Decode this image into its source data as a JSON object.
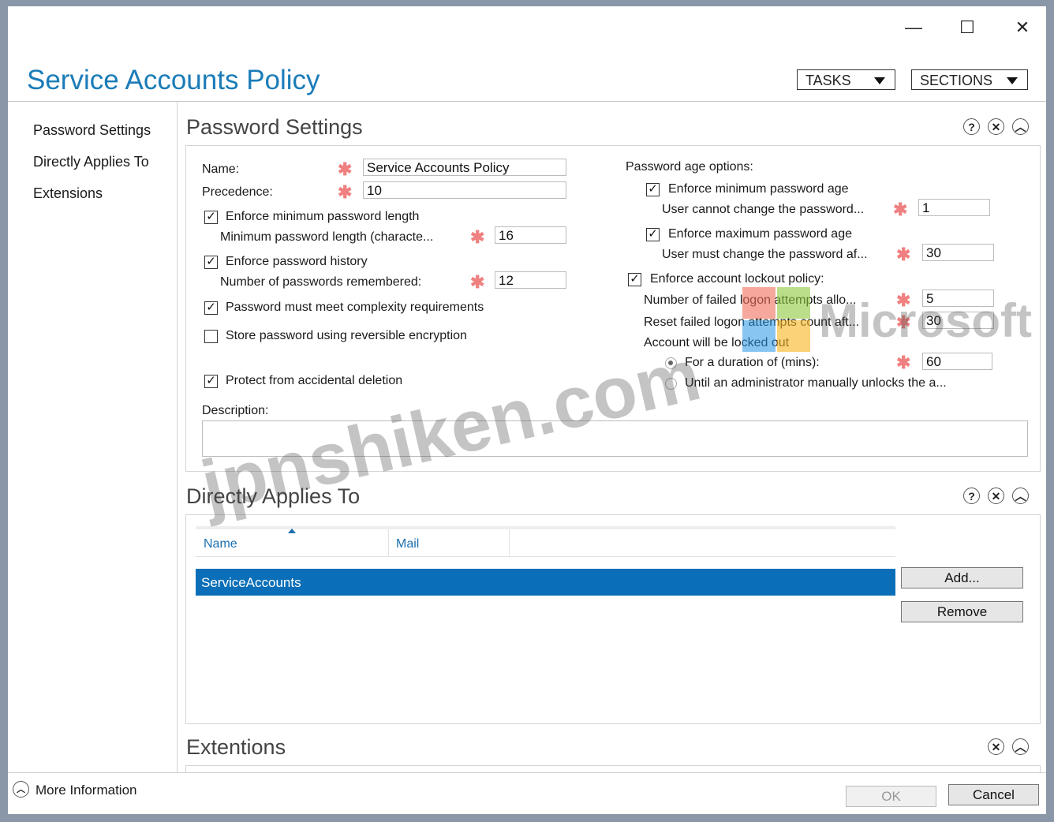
{
  "window": {
    "controls": {
      "minimize": "—",
      "maximize": "☐",
      "close": "✕"
    },
    "title": "Service Accounts Policy",
    "tasks_label": "TASKS",
    "sections_label": "SECTIONS"
  },
  "nav": {
    "items": [
      {
        "label": "Password Settings"
      },
      {
        "label": "Directly Applies To"
      },
      {
        "label": "Extensions"
      }
    ]
  },
  "password_settings": {
    "title": "Password Settings",
    "name_label": "Name:",
    "name_value": "Service Accounts Policy",
    "precedence_label": "Precedence:",
    "precedence_value": "10",
    "enforce_min_length": {
      "label": "Enforce minimum password length",
      "checked": true
    },
    "min_length_label": "Minimum password length (characte...",
    "min_length_value": "16",
    "enforce_history": {
      "label": "Enforce password history",
      "checked": true
    },
    "history_label": "Number of passwords remembered:",
    "history_value": "12",
    "complexity": {
      "label": "Password must meet complexity requirements",
      "checked": true
    },
    "reversible": {
      "label": "Store password using reversible encryption",
      "checked": false
    },
    "protect": {
      "label": "Protect from accidental deletion",
      "checked": true
    },
    "description_label": "Description:",
    "age_options_label": "Password age options:",
    "enforce_min_age": {
      "label": "Enforce minimum password age",
      "checked": true
    },
    "min_age_label": "User cannot change the password...",
    "min_age_value": "1",
    "enforce_max_age": {
      "label": "Enforce maximum password age",
      "checked": true
    },
    "max_age_label": "User must change the password af...",
    "max_age_value": "30",
    "enforce_lockout": {
      "label": "Enforce account lockout policy:",
      "checked": true
    },
    "failed_attempts_label": "Number of failed logon attempts allo...",
    "failed_attempts_value": "5",
    "reset_label": "Reset failed logon attempts count aft...",
    "reset_value": "30",
    "locked_out_label": "Account will be locked out",
    "duration_label": "For a duration of (mins):",
    "duration_value": "60",
    "until_admin_label": "Until an administrator manually unlocks the a...",
    "required_mark": "✱"
  },
  "directly_applies": {
    "title": "Directly Applies To",
    "col_name": "Name",
    "col_mail": "Mail",
    "rows": [
      {
        "name": "ServiceAccounts",
        "mail": ""
      }
    ],
    "add_label": "Add...",
    "remove_label": "Remove"
  },
  "extensions": {
    "title": "Extentions"
  },
  "footer": {
    "more_info": "More Information",
    "ok": "OK",
    "cancel": "Cancel"
  },
  "watermarks": {
    "site": "jpnshiken.com",
    "brand": "Microsoft"
  },
  "colors": {
    "accent": "#1b7cb8",
    "selection": "#0a6fb8",
    "required": "#f08080"
  }
}
